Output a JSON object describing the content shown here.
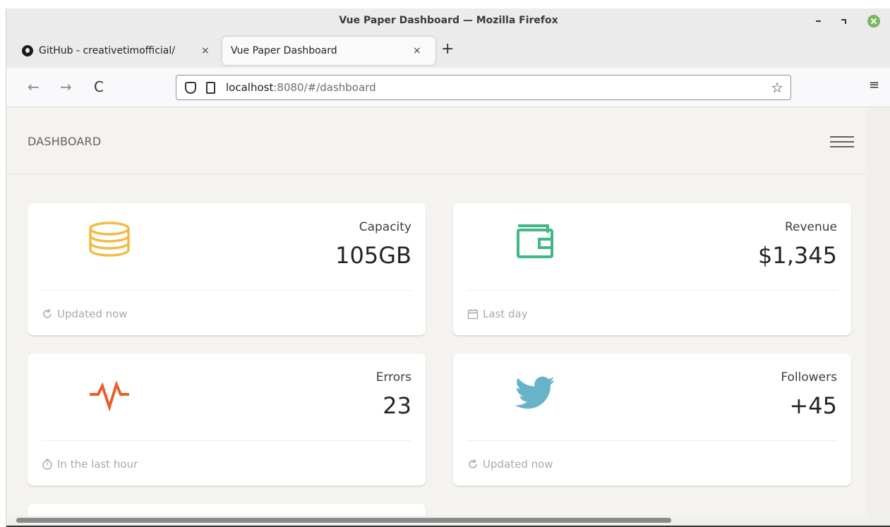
{
  "window": {
    "title": "Vue Paper Dashboard — Mozilla Firefox"
  },
  "tabs": [
    {
      "label": "GitHub - creativetimofficial/",
      "close": "×"
    },
    {
      "label": "Vue Paper Dashboard",
      "close": "×"
    }
  ],
  "new_tab": "+",
  "nav": {
    "back": "←",
    "forward": "→",
    "reload": "C",
    "url_host": "localhost",
    "url_rest": ":8080/#/dashboard",
    "bookmark": "☆",
    "menu": "≡"
  },
  "page": {
    "brand": "DASHBOARD",
    "cards": [
      {
        "category": "Capacity",
        "value": "105GB",
        "footer": "Updated now",
        "icon": "database-icon",
        "color": "#f3bb45"
      },
      {
        "category": "Revenue",
        "value": "$1,345",
        "footer": "Last day",
        "icon": "wallet-icon",
        "color": "#41b883"
      },
      {
        "category": "Errors",
        "value": "23",
        "footer": "In the last hour",
        "icon": "pulse-icon",
        "color": "#eb5e28"
      },
      {
        "category": "Followers",
        "value": "+45",
        "footer": "Updated now",
        "icon": "twitter-icon",
        "color": "#68b3c8"
      }
    ]
  },
  "colors": {
    "page_background": "#f4f3ef",
    "card_background": "#ffffff",
    "footer_text": "#a9a9a9"
  }
}
